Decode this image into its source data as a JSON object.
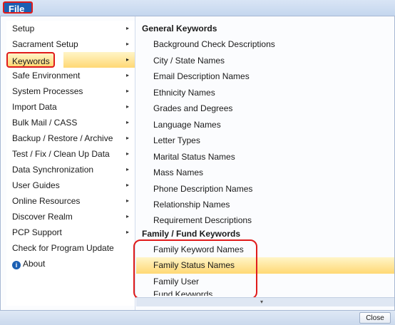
{
  "file_menu_label": "File",
  "left_menu": [
    {
      "label": "Setup",
      "has_submenu": true
    },
    {
      "label": "Sacrament Setup",
      "has_submenu": true
    },
    {
      "label": "Keywords",
      "has_submenu": true,
      "active": true
    },
    {
      "label": "Safe Environment",
      "has_submenu": true
    },
    {
      "label": "System Processes",
      "has_submenu": true
    },
    {
      "label": "Import Data",
      "has_submenu": true
    },
    {
      "label": "Bulk Mail / CASS",
      "has_submenu": true
    },
    {
      "label": "Backup / Restore / Archive",
      "has_submenu": true
    },
    {
      "label": "Test / Fix / Clean Up Data",
      "has_submenu": true
    },
    {
      "label": "Data Synchronization",
      "has_submenu": true
    },
    {
      "label": "User Guides",
      "has_submenu": true
    },
    {
      "label": "Online Resources",
      "has_submenu": true
    },
    {
      "label": "Discover Realm",
      "has_submenu": true
    },
    {
      "label": "PCP Support",
      "has_submenu": true
    },
    {
      "label": "Check for Program Update",
      "has_submenu": false
    },
    {
      "label": "About",
      "has_submenu": false,
      "icon": "info-icon"
    }
  ],
  "submenu_arrow": "▸",
  "general_section": {
    "heading": "General Keywords",
    "items": [
      "Background Check Descriptions",
      "City / State Names",
      "Email Description Names",
      "Ethnicity Names",
      "Grades and Degrees",
      "Language Names",
      "Letter Types",
      "Marital Status Names",
      "Mass Names",
      "Phone Description Names",
      "Relationship Names",
      "Requirement Descriptions"
    ]
  },
  "family_section": {
    "heading": "Family / Fund Keywords",
    "items": [
      "Family Keyword Names",
      "Family Status Names",
      "Family User",
      "Fund Keywords"
    ],
    "highlighted_item": "Family Status Names"
  },
  "scroll_down_glyph": "▾",
  "close_button_label": "Close",
  "colors": {
    "highlight": "#ffd874",
    "annotation_red": "#e01b1b",
    "file_blue": "#1b5fb3"
  }
}
